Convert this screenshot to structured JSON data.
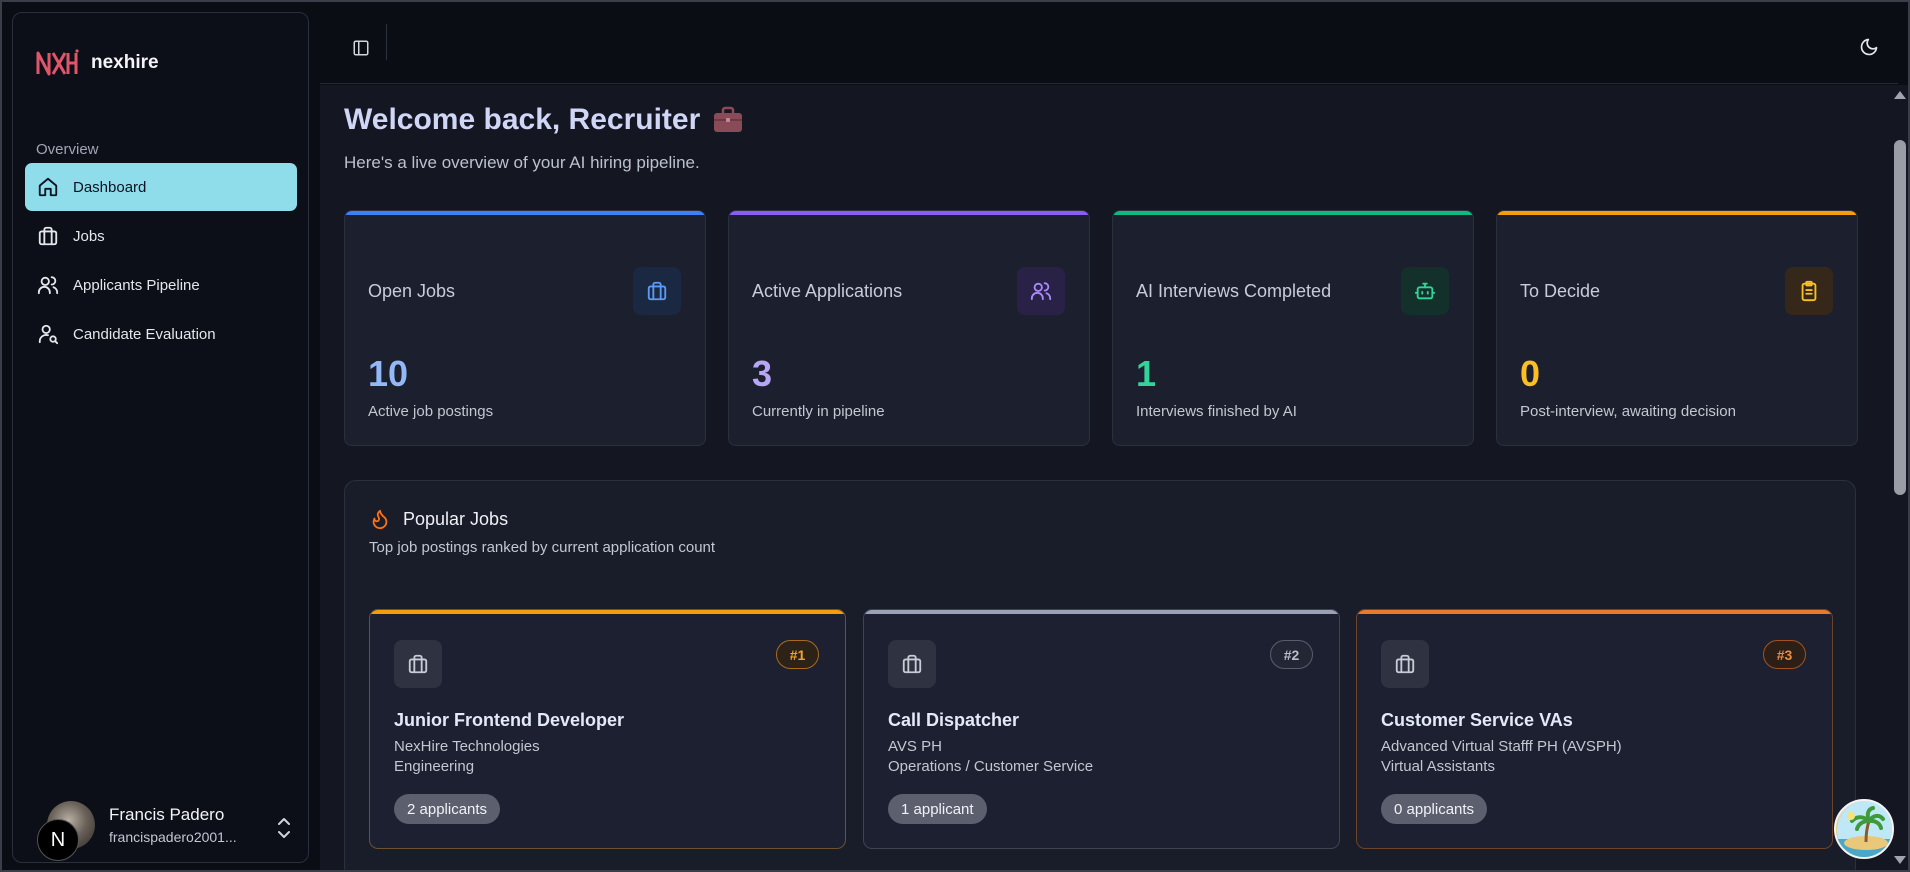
{
  "brand": {
    "name": "nexhire",
    "logo_icon": "nexhire-logo-icon",
    "logo_color": "#e0556a"
  },
  "sidebar": {
    "group_label": "Overview",
    "items": [
      {
        "label": "Dashboard",
        "icon": "home-icon",
        "active": true
      },
      {
        "label": "Jobs",
        "icon": "briefcase-icon",
        "active": false
      },
      {
        "label": "Applicants Pipeline",
        "icon": "users-icon",
        "active": false
      },
      {
        "label": "Candidate Evaluation",
        "icon": "user-search-icon",
        "active": false
      }
    ],
    "active_color": "#8fdcea"
  },
  "user": {
    "name": "Francis Padero",
    "email": "francispadero2001...",
    "badge_letter": "N"
  },
  "header": {
    "title": "Welcome back, Recruiter",
    "title_icon": "briefcase-emoji",
    "subtitle": "Here's a live overview of your AI hiring pipeline."
  },
  "stats": [
    {
      "label": "Open Jobs",
      "value": "10",
      "desc": "Active job postings",
      "icon": "briefcase-icon",
      "color": "#3b82f6",
      "value_color": "#93b8f8",
      "icon_bg": "#1b2842"
    },
    {
      "label": "Active Applications",
      "value": "3",
      "desc": "Currently in pipeline",
      "icon": "users-icon",
      "color": "#8b5cf6",
      "value_color": "#b7a6f4",
      "icon_bg": "#2a2146"
    },
    {
      "label": "AI Interviews Completed",
      "value": "1",
      "desc": "Interviews finished by AI",
      "icon": "robot-icon",
      "color": "#10b981",
      "value_color": "#34d399",
      "icon_bg": "#13302b"
    },
    {
      "label": "To Decide",
      "value": "0",
      "desc": "Post-interview, awaiting decision",
      "icon": "clipboard-icon",
      "color": "#f59e0b",
      "value_color": "#fbbf24",
      "icon_bg": "#35281b"
    }
  ],
  "popular": {
    "title": "Popular Jobs",
    "subtitle": "Top job postings ranked by current application count",
    "icon": "flame-icon",
    "jobs": [
      {
        "rank": "#1",
        "title": "Junior Frontend Developer",
        "company": "NexHire Technologies",
        "dept": "Engineering",
        "applicants": "2 applicants",
        "accent": "#f59e0b",
        "border": "#6b5230",
        "rank_color": "#f5a524"
      },
      {
        "rank": "#2",
        "title": "Call Dispatcher",
        "company": "AVS PH",
        "dept": "Operations / Customer Service",
        "applicants": "1 applicant",
        "accent": "#9aa1b5",
        "border": "#3f4352",
        "rank_color": "#b9bfce"
      },
      {
        "rank": "#3",
        "title": "Customer Service VAs",
        "company": "Advanced Virtual Stafff PH (AVSPH)",
        "dept": "Virtual Assistants",
        "applicants": "0 applicants",
        "accent": "#ea7a2a",
        "border": "#6b4429",
        "rank_color": "#f08a3c"
      }
    ]
  }
}
